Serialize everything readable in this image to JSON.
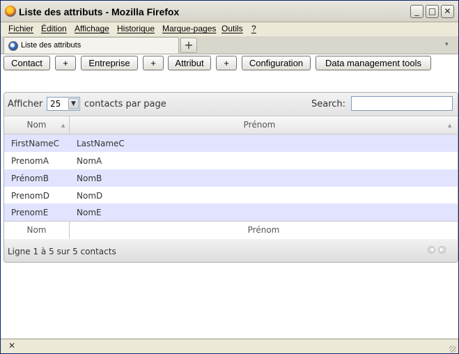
{
  "window": {
    "title": "Liste des attributs - Mozilla Firefox",
    "controls": {
      "minimize": "_",
      "maximize": "□",
      "close": "✕"
    }
  },
  "menubar": {
    "items": [
      "Fichier",
      "Édition",
      "Affichage",
      "Historique",
      "Marque-pages",
      "Outils",
      "?"
    ]
  },
  "tabs": {
    "active_label": "Liste des attributs",
    "new_tab": "+",
    "list_arrow": "▾"
  },
  "toolbar": {
    "contact": "Contact",
    "plus1": "+",
    "entreprise": "Entreprise",
    "plus2": "+",
    "attribut": "Attribut",
    "plus3": "+",
    "configuration": "Configuration",
    "data_tools": "Data management tools"
  },
  "datatable": {
    "length_prefix": "Afficher",
    "length_value": "25",
    "length_suffix": "contacts par page",
    "search_label": "Search:",
    "search_value": "",
    "columns": [
      "Nom",
      "Prénom"
    ],
    "rows": [
      [
        "FirstNameC",
        "LastNameC"
      ],
      [
        "PrenomA",
        "NomA"
      ],
      [
        "PrénomB",
        "NomB"
      ],
      [
        "PrenomD",
        "NomD"
      ],
      [
        "PrenomE",
        "NomE"
      ]
    ],
    "footer_columns": [
      "Nom",
      "Prénom"
    ],
    "info": "Ligne 1 à 5 sur 5 contacts"
  },
  "statusbar": {
    "close_glyph": "✕"
  }
}
